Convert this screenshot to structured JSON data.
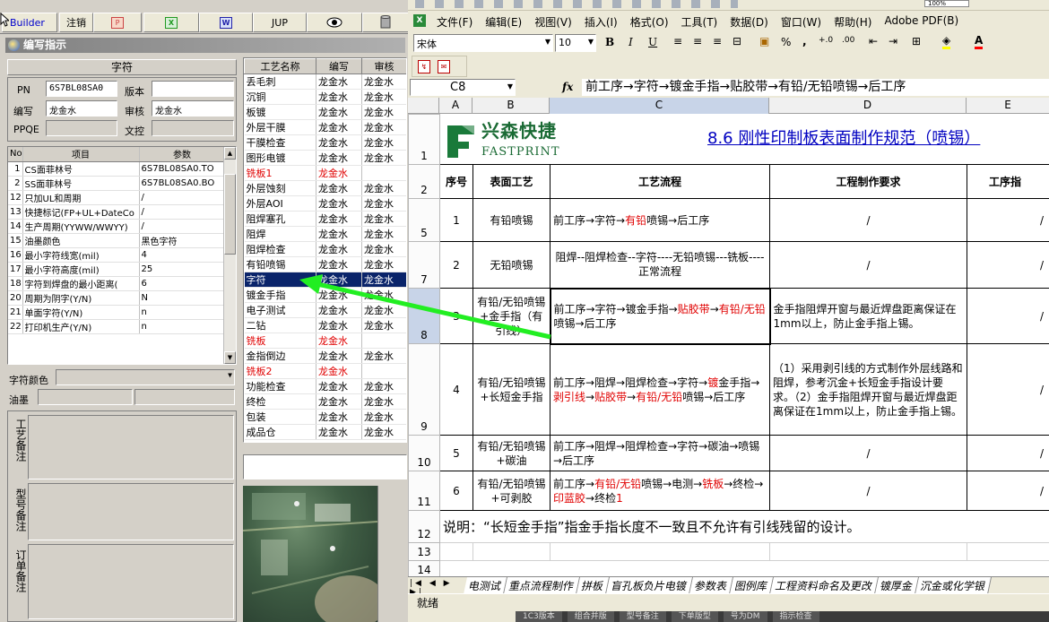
{
  "left_app": {
    "toolbar": {
      "builder_label": "Builder",
      "logout_label": "注销",
      "jump_label": "JUP"
    },
    "dialog_title": "编写指示",
    "section_title": "字符",
    "fields": {
      "pn_label": "PN",
      "pn_value": "6S7BL08SA0",
      "version_label": "版本",
      "version_value": "",
      "author_label": "编写",
      "author_value": "龙金水",
      "review_label": "审核",
      "review_value": "龙金水",
      "ppqe_label": "PPQE",
      "ppqe_value": "",
      "control_label": "文控",
      "control_value": ""
    },
    "param_table": {
      "headers": [
        "No",
        "项目",
        "参数"
      ],
      "rows": [
        {
          "no": "1",
          "item": "CS面菲林号",
          "value": "6S7BL08SA0.TO"
        },
        {
          "no": "2",
          "item": "SS面菲林号",
          "value": "6S7BL08SA0.BO"
        },
        {
          "no": "12",
          "item": "只加UL和周期",
          "value": "/"
        },
        {
          "no": "13",
          "item": "快捷标记(FP+UL+DateCo",
          "value": "/"
        },
        {
          "no": "14",
          "item": "生产周期(YYWW/WWYY)",
          "value": "/"
        },
        {
          "no": "15",
          "item": "油墨颜色",
          "value": "黑色字符"
        },
        {
          "no": "16",
          "item": "最小字符线宽(mil)",
          "value": "4"
        },
        {
          "no": "17",
          "item": "最小字符高度(mil)",
          "value": "25"
        },
        {
          "no": "18",
          "item": "字符到焊盘的最小距离(",
          "value": "6"
        },
        {
          "no": "20",
          "item": "周期为阴字(Y/N)",
          "value": "N"
        },
        {
          "no": "21",
          "item": "单面字符(Y/N)",
          "value": "n"
        },
        {
          "no": "22",
          "item": "打印机生产(Y/N)",
          "value": "n"
        }
      ]
    },
    "char_color_label": "字符颜色",
    "ink_label": "油墨",
    "remarks": {
      "process_note": "工艺备注",
      "model_note": "型号备注",
      "order_note": "订单备注"
    },
    "process_table": {
      "headers": [
        "工艺名称",
        "编写",
        "审核"
      ],
      "rows": [
        {
          "name": "丢毛刺",
          "author": "龙金水",
          "reviewer": "龙金水",
          "red": false
        },
        {
          "name": "沉铜",
          "author": "龙金水",
          "reviewer": "龙金水",
          "red": false
        },
        {
          "name": "板镀",
          "author": "龙金水",
          "reviewer": "龙金水",
          "red": false
        },
        {
          "name": "外层干膜",
          "author": "龙金水",
          "reviewer": "龙金水",
          "red": false
        },
        {
          "name": "干膜检查",
          "author": "龙金水",
          "reviewer": "龙金水",
          "red": false
        },
        {
          "name": "图形电镀",
          "author": "龙金水",
          "reviewer": "龙金水",
          "red": false
        },
        {
          "name": "铣板1",
          "author": "龙金水",
          "reviewer": "",
          "red": true
        },
        {
          "name": "外层蚀刻",
          "author": "龙金水",
          "reviewer": "龙金水",
          "red": false
        },
        {
          "name": "外层AOI",
          "author": "龙金水",
          "reviewer": "龙金水",
          "red": false
        },
        {
          "name": "阻焊塞孔",
          "author": "龙金水",
          "reviewer": "龙金水",
          "red": false
        },
        {
          "name": "阻焊",
          "author": "龙金水",
          "reviewer": "龙金水",
          "red": false
        },
        {
          "name": "阻焊检查",
          "author": "龙金水",
          "reviewer": "龙金水",
          "red": false
        },
        {
          "name": "有铅喷锡",
          "author": "龙金水",
          "reviewer": "龙金水",
          "red": false
        },
        {
          "name": "字符",
          "author": "龙金水",
          "reviewer": "龙金水",
          "red": false,
          "selected": true
        },
        {
          "name": "镀金手指",
          "author": "龙金水",
          "reviewer": "龙金水",
          "red": false
        },
        {
          "name": "电子测试",
          "author": "龙金水",
          "reviewer": "龙金水",
          "red": false
        },
        {
          "name": "二钻",
          "author": "龙金水",
          "reviewer": "龙金水",
          "red": false
        },
        {
          "name": "铣板",
          "author": "龙金水",
          "reviewer": "",
          "red": true
        },
        {
          "name": "金指倒边",
          "author": "龙金水",
          "reviewer": "龙金水",
          "red": false
        },
        {
          "name": "铣板2",
          "author": "龙金水",
          "reviewer": "",
          "red": true
        },
        {
          "name": "功能检查",
          "author": "龙金水",
          "reviewer": "龙金水",
          "red": false
        },
        {
          "name": "终检",
          "author": "龙金水",
          "reviewer": "龙金水",
          "red": false
        },
        {
          "name": "包装",
          "author": "龙金水",
          "reviewer": "龙金水",
          "red": false
        },
        {
          "name": "成品仓",
          "author": "龙金水",
          "reviewer": "龙金水",
          "red": false
        }
      ]
    }
  },
  "excel": {
    "menu": [
      "文件(F)",
      "编辑(E)",
      "视图(V)",
      "插入(I)",
      "格式(O)",
      "工具(T)",
      "数据(D)",
      "窗口(W)",
      "帮助(H)",
      "Adobe PDF(B)"
    ],
    "font_name": "宋体",
    "font_size": "10",
    "zoom": "100%",
    "name_box": "C8",
    "fx_label": "fx",
    "formula": "前工序→字符→镀金手指→贴胶带→有铅/无铅喷锡→后工序",
    "columns": [
      "A",
      "B",
      "C",
      "D",
      "E"
    ],
    "logo_cn": "兴森快捷",
    "logo_en": "FASTPRINT",
    "doc_title": "8.6 刚性印制板表面制作规范（喷锡）",
    "header_row": [
      "序号",
      "表面工艺",
      "工艺流程",
      "工程制作要求",
      "工序指"
    ],
    "rows": [
      {
        "no": "1",
        "surface": "有铅喷锡",
        "flow_html": "前工序→字符→<span class='red'>有铅</span>喷锡→后工序",
        "req": "/",
        "e": "/"
      },
      {
        "no": "2",
        "surface": "无铅喷锡",
        "flow_html": "阻焊--阻焊检查--字符----无铅喷锡---铣板----正常流程",
        "req": "/",
        "e": "/"
      },
      {
        "no": "3",
        "surface": "有铅/无铅喷锡+金手指（有引线）",
        "flow_html": "前工序→字符→镀金手指→<span class='red'>贴胶带</span>→<span class='red'>有铅/无铅</span>喷锡→后工序",
        "req": "金手指阻焊开窗与最近焊盘距离保证在1mm以上，防止金手指上锡。",
        "e": "/"
      },
      {
        "no": "4",
        "surface": "有铅/无铅喷锡+长短金手指",
        "flow_html": "前工序→阻焊→阻焊检查→字符→<span class='red'>镀</span>金手指→<span class='red'>剥引线</span>→<span class='red'>贴胶带</span>→<span class='red'>有铅/无铅</span>喷锡→后工序",
        "req": "（1）采用剥引线的方式制作外层线路和阻焊，参考沉金+长短金手指设计要求。（2）金手指阻焊开窗与最近焊盘距离保证在1mm以上，防止金手指上锡。",
        "e": "/"
      },
      {
        "no": "5",
        "surface": "有铅/无铅喷锡+碳油",
        "flow_html": "前工序→阻焊→阻焊检查→字符→碳油→喷锡→后工序",
        "req": "/",
        "e": "/"
      },
      {
        "no": "6",
        "surface": "有铅/无铅喷锡+可剥胶",
        "flow_html": "前工序→<span class='red'>有铅/无铅</span>喷锡→电测→<span class='red'>铣板</span>→终检→<span class='red'>印蓝胶</span>→终检<span class='red'>1</span>",
        "req": "/",
        "e": "/"
      }
    ],
    "note": "说明：“长短金手指”指金手指长度不一致且不允许有引线残留的设计。",
    "sheet_tabs": [
      "电测试",
      "重点流程制作",
      "拼板",
      "盲孔板负片电镀",
      "参数表",
      "图例库",
      "工程资料命名及更改",
      "镀厚金",
      "沉金或化学银"
    ],
    "status": "就绪"
  },
  "taskbar_fragments": [
    "1C3版本",
    "组合并版",
    "型号备注",
    "下单版型",
    "号为DM",
    "指示检查"
  ]
}
